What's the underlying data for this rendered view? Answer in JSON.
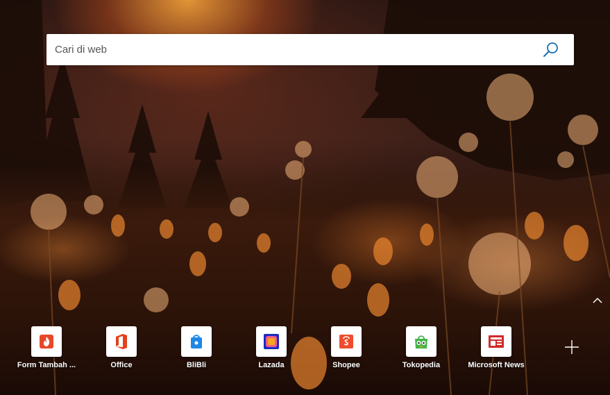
{
  "search": {
    "placeholder": "Cari di web",
    "value": ""
  },
  "quick_links": [
    {
      "label": "Form Tambah ...",
      "icon": "fire-icon",
      "color": "#e8482a"
    },
    {
      "label": "Office",
      "icon": "office-icon",
      "color": "#e3401c"
    },
    {
      "label": "BliBli",
      "icon": "blibli-icon",
      "color": "#1e88e5"
    },
    {
      "label": "Lazada",
      "icon": "lazada-icon",
      "color": "#1a2bbf"
    },
    {
      "label": "Shopee",
      "icon": "shopee-icon",
      "color": "#ee4d2d"
    },
    {
      "label": "Tokopedia",
      "icon": "tokopedia-icon",
      "color": "#42b549"
    },
    {
      "label": "Microsoft News",
      "icon": "news-icon",
      "color": "#d12a2a"
    }
  ],
  "controls": {
    "collapse_icon": "chevron-up-icon",
    "add_icon": "plus-icon"
  }
}
